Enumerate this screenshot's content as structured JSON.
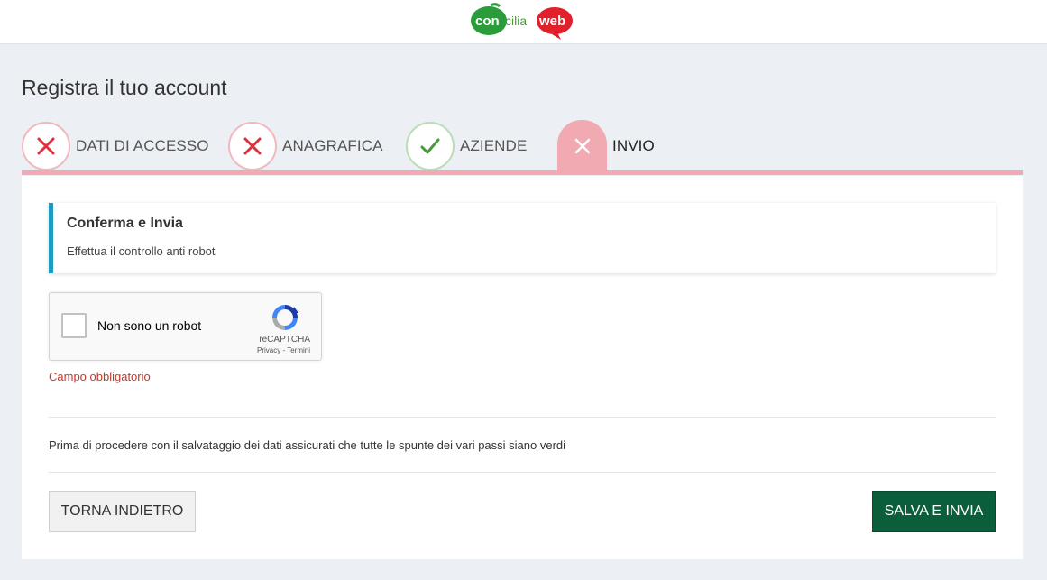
{
  "header": {
    "logo_part1": "con",
    "logo_part2": "cilia",
    "logo_part3": "web"
  },
  "page": {
    "title": "Registra il tuo account"
  },
  "steps": [
    {
      "label": "DATI DI ACCESSO",
      "status": "error"
    },
    {
      "label": "ANAGRAFICA",
      "status": "error"
    },
    {
      "label": "AZIENDE",
      "status": "ok"
    },
    {
      "label": "INVIO",
      "status": "active"
    }
  ],
  "callout": {
    "title": "Conferma e Invia",
    "text": "Effettua il controllo anti robot"
  },
  "captcha": {
    "label": "Non sono un robot",
    "brand": "reCAPTCHA",
    "links": "Privacy - Termini",
    "checked": false
  },
  "validation": {
    "error": "Campo obbligatorio"
  },
  "note": "Prima di procedere con il salvataggio dei dati assicurati che tutte le spunte dei vari passi siano verdi",
  "buttons": {
    "back": "TORNA INDIETRO",
    "submit": "SALVA E INVIA"
  },
  "colors": {
    "error": "#e0303e",
    "ok": "#4c9a3e",
    "active": "#f1a9b2",
    "accent_info": "#1c9cc0",
    "submit": "#0b5e3a"
  }
}
